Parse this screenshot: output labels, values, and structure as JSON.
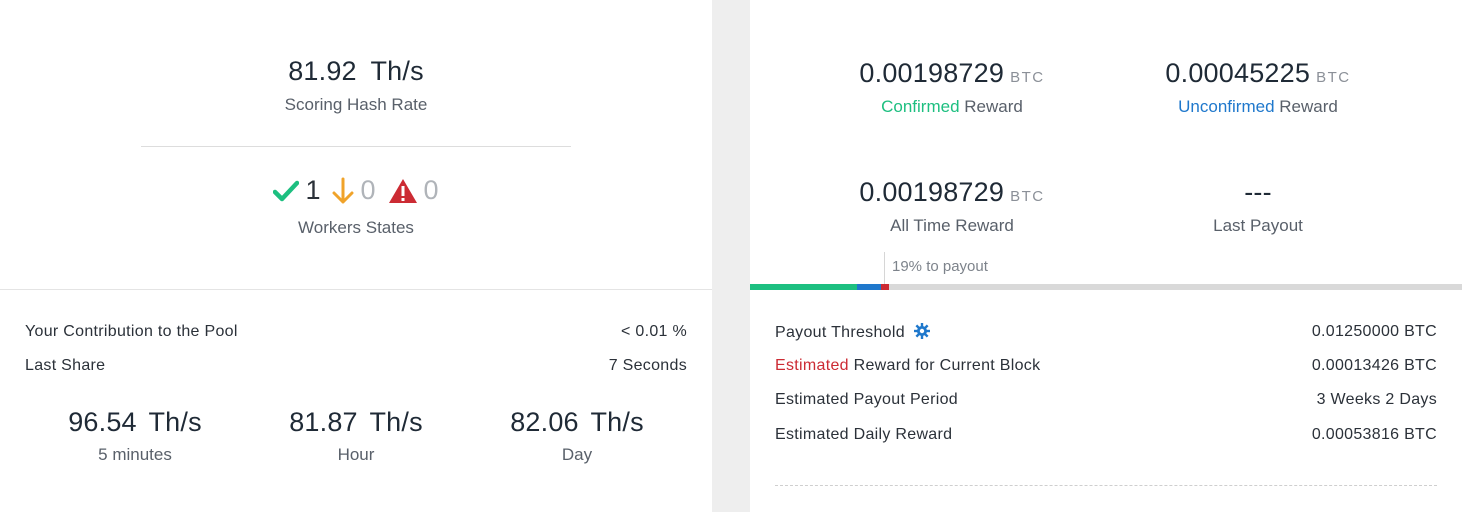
{
  "left": {
    "scoring": {
      "value": "81.92",
      "unit": "Th/s",
      "label": "Scoring Hash Rate"
    },
    "workers": {
      "ok_count": "1",
      "low_count": "0",
      "dead_count": "0",
      "label": "Workers States"
    },
    "stats": {
      "contribution_label": "Your Contribution to the Pool",
      "contribution_value": "< 0.01 %",
      "last_share_label": "Last Share",
      "last_share_value": "7 Seconds"
    },
    "rates": [
      {
        "value": "96.54",
        "unit": "Th/s",
        "label": "5 minutes"
      },
      {
        "value": "81.87",
        "unit": "Th/s",
        "label": "Hour"
      },
      {
        "value": "82.06",
        "unit": "Th/s",
        "label": "Day"
      }
    ]
  },
  "right": {
    "confirmed": {
      "value": "0.00198729",
      "unit": "BTC",
      "label_accent": "Confirmed",
      "label_rest": " Reward"
    },
    "unconfirmed": {
      "value": "0.00045225",
      "unit": "BTC",
      "label_accent": "Unconfirmed",
      "label_rest": " Reward"
    },
    "all_time": {
      "value": "0.00198729",
      "unit": "BTC",
      "label": "All Time Reward"
    },
    "last_payout": {
      "value": "---",
      "label": "Last Payout"
    },
    "payout_progress_text": "19% to payout",
    "payout_progress": {
      "confirmed_fraction": 0.15,
      "unconfirmed_fraction": 0.034,
      "estimated_fraction": 0.011
    },
    "rows": {
      "threshold_label": "Payout Threshold",
      "threshold_value": "0.01250000 BTC",
      "est_block_accent": "Estimated",
      "est_block_rest": " Reward for Current Block",
      "est_block_value": "0.00013426 BTC",
      "period_label": "Estimated Payout Period",
      "period_value": "3 Weeks 2 Days",
      "daily_label": "Estimated Daily Reward",
      "daily_value": "0.00053816 BTC"
    }
  },
  "colors": {
    "confirmed": "#1dbf80",
    "unconfirmed": "#1f78cc",
    "estimated": "#cc2b34",
    "warning": "#f0a32a"
  },
  "icons": [
    "check-icon",
    "arrow-down-icon",
    "warning-triangle-icon",
    "gear-icon"
  ]
}
